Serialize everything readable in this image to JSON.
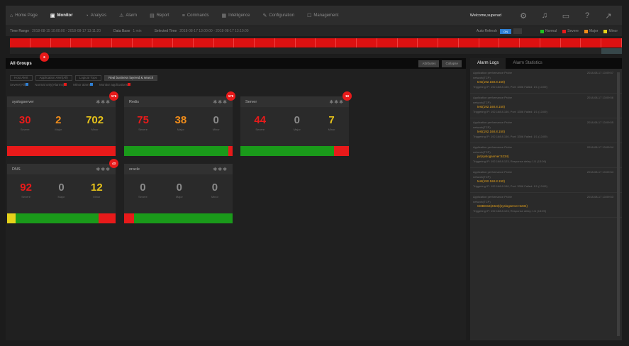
{
  "nav": {
    "items": [
      {
        "label": "Home Page",
        "icon": "home-icon",
        "glyph": "⌂",
        "active": false
      },
      {
        "label": "Monitor",
        "icon": "monitor-icon",
        "glyph": "▣",
        "active": true
      },
      {
        "label": "Analysis",
        "icon": "analysis-icon",
        "glyph": "◔",
        "active": false
      },
      {
        "label": "Alarm",
        "icon": "alarm-icon",
        "glyph": "⚠",
        "active": false
      },
      {
        "label": "Report",
        "icon": "report-icon",
        "glyph": "▤",
        "active": false
      },
      {
        "label": "Commands",
        "icon": "commands-icon",
        "glyph": "≡",
        "active": false
      },
      {
        "label": "Intelligence",
        "icon": "intelligence-icon",
        "glyph": "▦",
        "active": false
      },
      {
        "label": "Configuration",
        "icon": "configuration-icon",
        "glyph": "✎",
        "active": false
      },
      {
        "label": "Management",
        "icon": "management-icon",
        "glyph": "☐",
        "active": false
      }
    ],
    "welcome": "Welcome,superad",
    "icons": [
      {
        "name": "gear-icon",
        "glyph": "⚙"
      },
      {
        "name": "bell-icon",
        "glyph": "♫"
      },
      {
        "name": "message-icon",
        "glyph": "▭"
      },
      {
        "name": "help-icon",
        "glyph": "?"
      },
      {
        "name": "logout-icon",
        "glyph": "↗"
      }
    ]
  },
  "timebar": {
    "time_range_label": "Time Range",
    "time_range_value": "2018-08-15 10:00:00 - 2018-08-17 13:11:20",
    "data_base_label": "Data Base",
    "data_base_value": "1 min",
    "selected_label": "Selected Time",
    "selected_value": "2018-08-17 13:00:00 - 2018-08-17 13:10:00",
    "auto_refresh_label": "Auto Refresh",
    "auto_refresh_state": "ON",
    "legend": [
      {
        "label": "Normal",
        "color": "#1fbf1f"
      },
      {
        "label": "Severe",
        "color": "#e81a1a"
      },
      {
        "label": "Major",
        "color": "#f08c1a"
      },
      {
        "label": "Minor",
        "color": "#e6d21a"
      }
    ]
  },
  "groups": {
    "title": "All Groups",
    "badge": "6",
    "buttons": [
      "Attributes",
      "Collapse"
    ]
  },
  "filters": {
    "chips": [
      "Host Alert",
      "Application Alert(All)",
      "Logical Topo",
      "Real business layered & search"
    ],
    "active_index": 3,
    "severity": [
      {
        "label": "Severe(All)",
        "color": "#2f7fd3"
      },
      {
        "label": "Normal only(Alarms)",
        "color": "#e81a1a"
      },
      {
        "label": "Minor alarm",
        "color": "#2f7fd3"
      },
      {
        "label": "Monitor applications",
        "color": "#e81a1a"
      }
    ]
  },
  "cards": [
    {
      "name": "syslogserver",
      "badge": "176",
      "stats": [
        {
          "value": "30",
          "label": "Severe",
          "color": "#e81a1a"
        },
        {
          "value": "2",
          "label": "Major",
          "color": "#f08c1a"
        },
        {
          "value": "702",
          "label": "Minor",
          "color": "#e6c21a"
        }
      ],
      "bar": [
        {
          "pct": 100,
          "color": "#e81a1a"
        }
      ]
    },
    {
      "name": "Redis",
      "badge": "170",
      "stats": [
        {
          "value": "75",
          "label": "Severe",
          "color": "#e81a1a"
        },
        {
          "value": "38",
          "label": "Major",
          "color": "#f08c1a"
        },
        {
          "value": "0",
          "label": "Minor",
          "color": "#8a8a8a"
        }
      ],
      "bar": [
        {
          "pct": 96,
          "color": "#1a9a1a"
        },
        {
          "pct": 4,
          "color": "#e81a1a"
        }
      ]
    },
    {
      "name": "Server",
      "badge": "18",
      "stats": [
        {
          "value": "44",
          "label": "Severe",
          "color": "#e81a1a"
        },
        {
          "value": "0",
          "label": "Major",
          "color": "#8a8a8a"
        },
        {
          "value": "7",
          "label": "Minor",
          "color": "#e6c21a"
        }
      ],
      "bar": [
        {
          "pct": 86,
          "color": "#1a9a1a"
        },
        {
          "pct": 14,
          "color": "#e81a1a"
        }
      ]
    },
    {
      "name": "DNS",
      "badge": "43",
      "stats": [
        {
          "value": "92",
          "label": "Severe",
          "color": "#e81a1a"
        },
        {
          "value": "0",
          "label": "Major",
          "color": "#8a8a8a"
        },
        {
          "value": "12",
          "label": "Minor",
          "color": "#e6c21a"
        }
      ],
      "bar": [
        {
          "pct": 8,
          "color": "#e6d21a"
        },
        {
          "pct": 76,
          "color": "#1a9a1a"
        },
        {
          "pct": 16,
          "color": "#e81a1a"
        }
      ]
    },
    {
      "name": "oracle",
      "badge": "",
      "stats": [
        {
          "value": "0",
          "label": "Severe",
          "color": "#8a8a8a"
        },
        {
          "value": "0",
          "label": "Major",
          "color": "#8a8a8a"
        },
        {
          "value": "0",
          "label": "Minor",
          "color": "#8a8a8a"
        }
      ],
      "bar": [
        {
          "pct": 9,
          "color": "#e81a1a"
        },
        {
          "pct": 91,
          "color": "#1a9a1a"
        }
      ]
    }
  ],
  "alarm_panel": {
    "tabs": [
      "Alarm Logs",
      "Alarm Statistics"
    ],
    "logs": [
      {
        "title": "Application performance Probe",
        "time": "2018-08-17 13:09:57",
        "sub": "network(TCP)",
        "host": "test(192.168.8.150)",
        "detail": "Triggering IP: 192.168.8.150, Port: 3306 Failed: 1/1 (13:09)"
      },
      {
        "title": "Application performance Probe",
        "time": "2018-08-17 13:09:56",
        "sub": "network(TCP)",
        "host": "test(192.168.8.150)",
        "detail": "Triggering IP: 192.168.8.150, Port: 3306 Failed: 1/1 (13:09)"
      },
      {
        "title": "Application performance Probe",
        "time": "2018-08-17 13:09:55",
        "sub": "network(TCP)",
        "host": "test(192.168.8.150)",
        "detail": "Triggering IP: 192.168.8.150, Port: 3306 Failed: 1/1 (13:09)"
      },
      {
        "title": "Application performance Probe",
        "time": "2018-08-17 13:09:54",
        "sub": "network(TCP)",
        "host": "jar(syslogserver:5234)",
        "detail": "Triggering IP: 192.168.8.123, Response delay: 1/1 (13:09)"
      },
      {
        "title": "Application performance Probe",
        "time": "2018-08-17 13:09:54",
        "sub": "network(TCP)",
        "host": "test(192.168.8.150)",
        "detail": "Triggering IP: 192.168.8.150, Port: 3306 Failed: 1/1 (13:09)"
      },
      {
        "title": "Application performance Probe",
        "time": "2018-08-17 13:09:53",
        "sub": "network(TCP)",
        "host": "CDBGS2(2323)(syslogserver:5234)",
        "detail": "Triggering IP: 192.168.8.123, Response delay: 1/1 (13:09)"
      }
    ]
  }
}
